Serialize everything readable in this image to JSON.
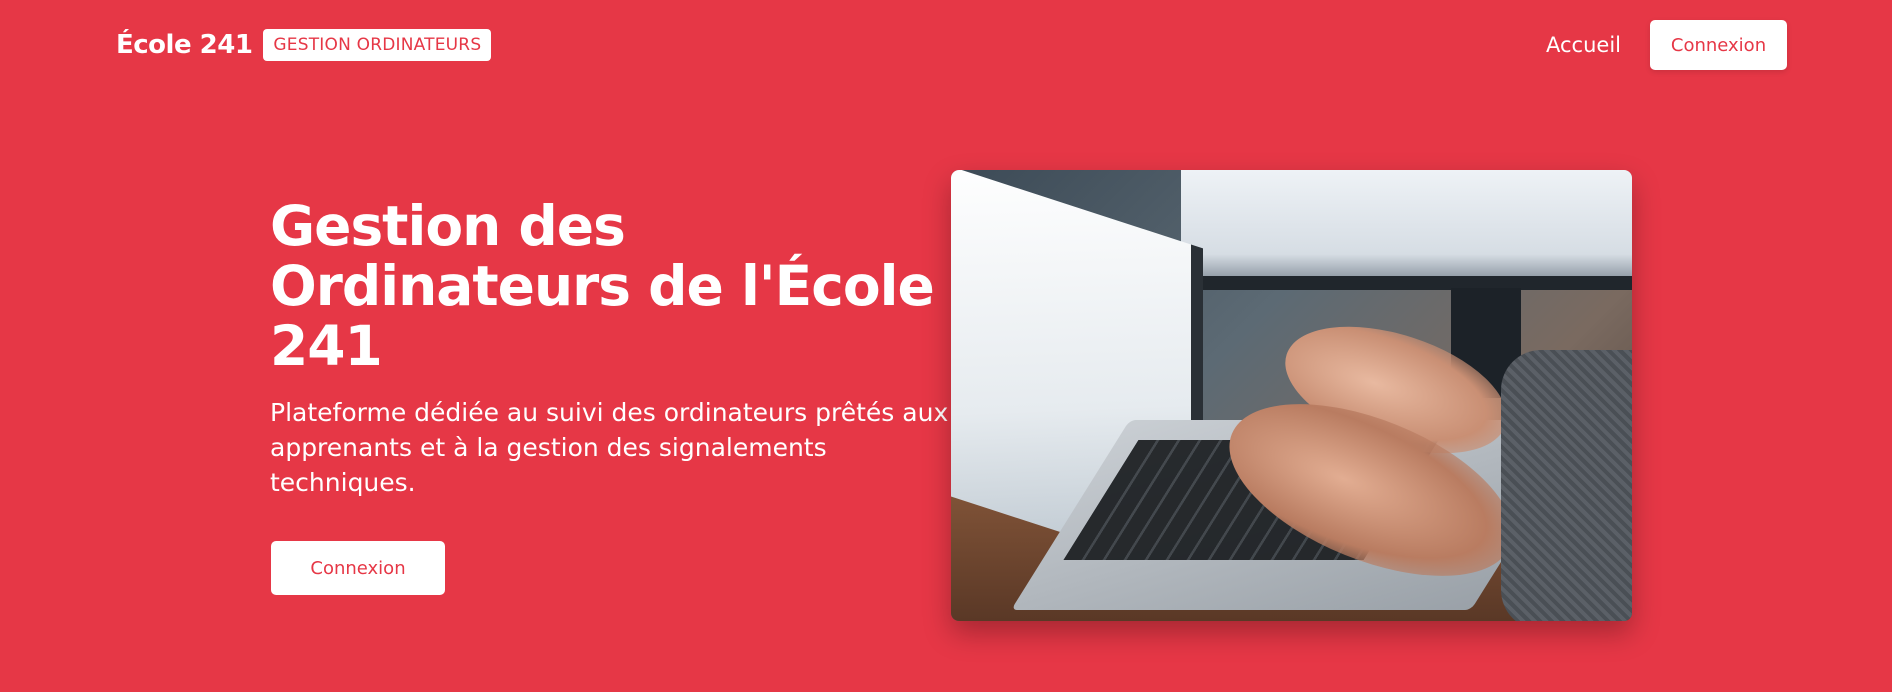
{
  "navbar": {
    "brand_name": "École 241",
    "brand_badge": "GESTION ORDINATEURS",
    "home_link": "Accueil",
    "login_button": "Connexion"
  },
  "hero": {
    "title": "Gestion des Ordinateurs de l'École 241",
    "subtitle": "Plateforme dédiée au suivi des ordinateurs prêtés aux apprenants et à la gestion des signalements techniques.",
    "cta_button": "Connexion",
    "image_description_icon": "laptop-typing-photo"
  },
  "colors": {
    "primary": "#e63746",
    "surface": "#ffffff",
    "text_on_primary": "#ffffff"
  }
}
